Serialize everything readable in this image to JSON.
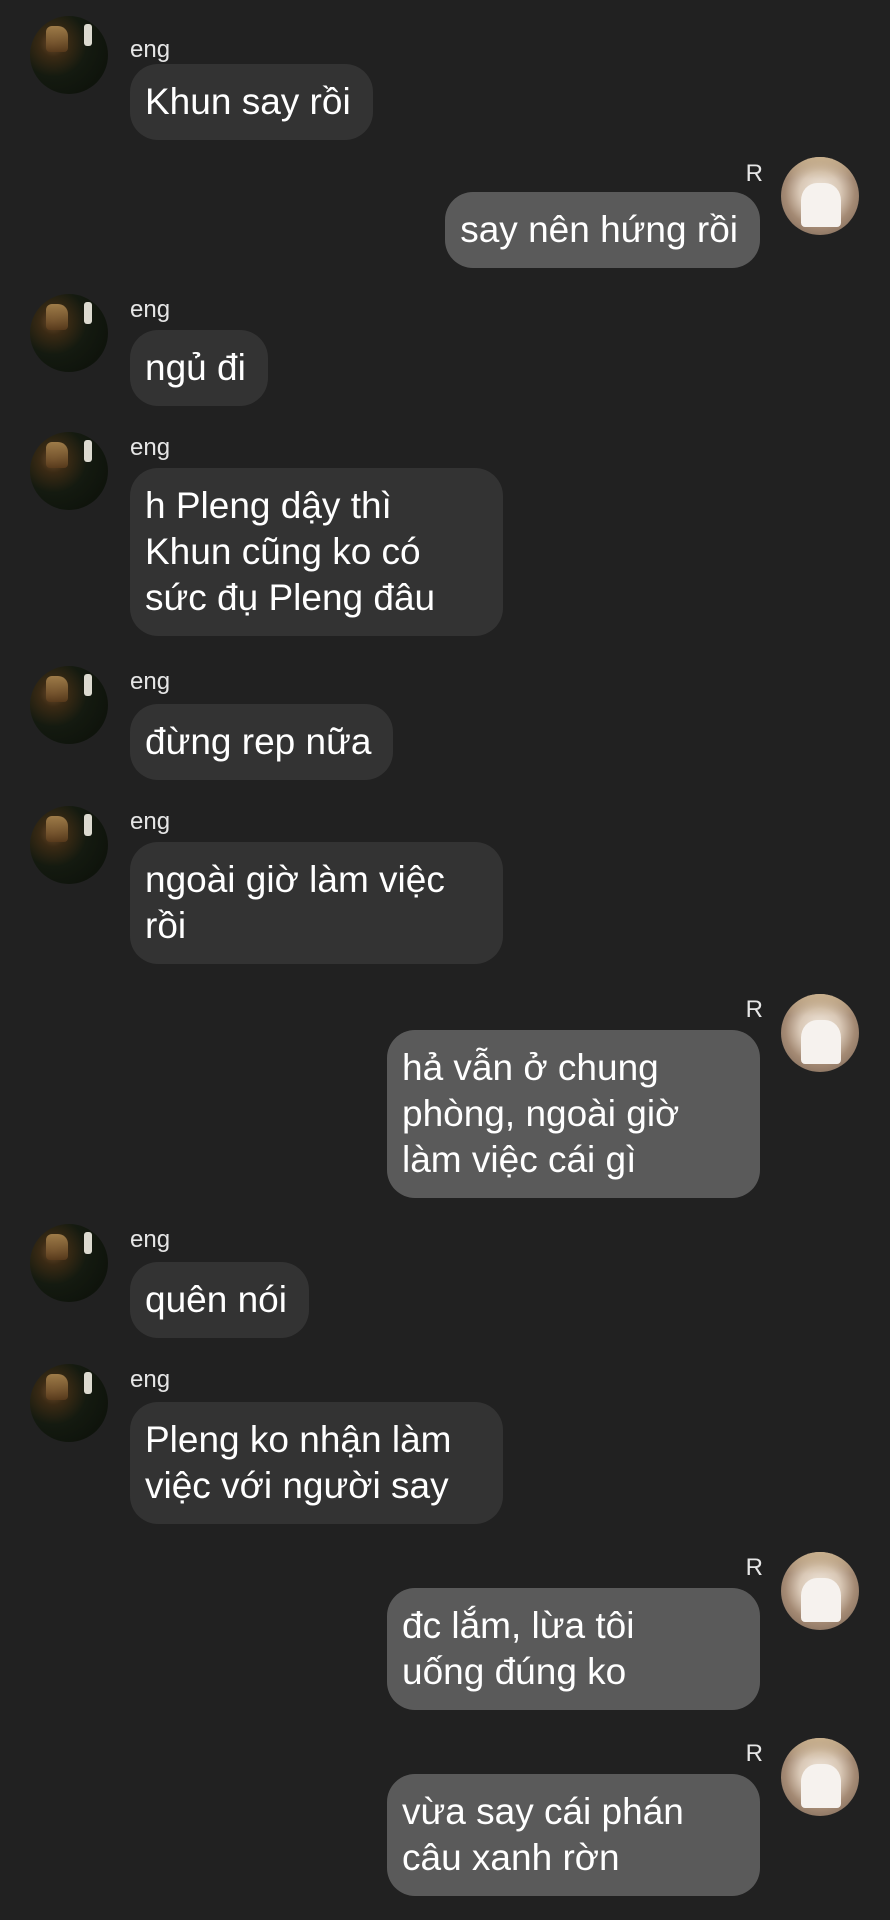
{
  "conversation": {
    "messages": [
      {
        "direction": "in",
        "sender": "eng",
        "text": "Khun say rồi"
      },
      {
        "direction": "out",
        "sender": "R",
        "text": "say nên hứng rồi"
      },
      {
        "direction": "in",
        "sender": "eng",
        "text": "ngủ đi"
      },
      {
        "direction": "in",
        "sender": "eng",
        "text": "h Pleng dậy thì\nKhun cũng ko có\nsức đụ Pleng đâu"
      },
      {
        "direction": "in",
        "sender": "eng",
        "text": "đừng rep nữa"
      },
      {
        "direction": "in",
        "sender": "eng",
        "text": "ngoài giờ làm việc\nrồi"
      },
      {
        "direction": "out",
        "sender": "R",
        "text": "hả vẫn ở chung\nphòng, ngoài giờ\nlàm việc cái gì"
      },
      {
        "direction": "in",
        "sender": "eng",
        "text": "quên nói"
      },
      {
        "direction": "in",
        "sender": "eng",
        "text": "Pleng ko nhận làm\nviệc với người say"
      },
      {
        "direction": "out",
        "sender": "R",
        "text": "đc lắm, lừa tôi\nuống đúng ko"
      },
      {
        "direction": "out",
        "sender": "R",
        "text": "vừa say cái phán\ncâu xanh rờn"
      }
    ]
  },
  "colors": {
    "background": "#212121",
    "incoming_bubble": "#333333",
    "outgoing_bubble": "#5a5a5a",
    "text": "#ffffff"
  }
}
